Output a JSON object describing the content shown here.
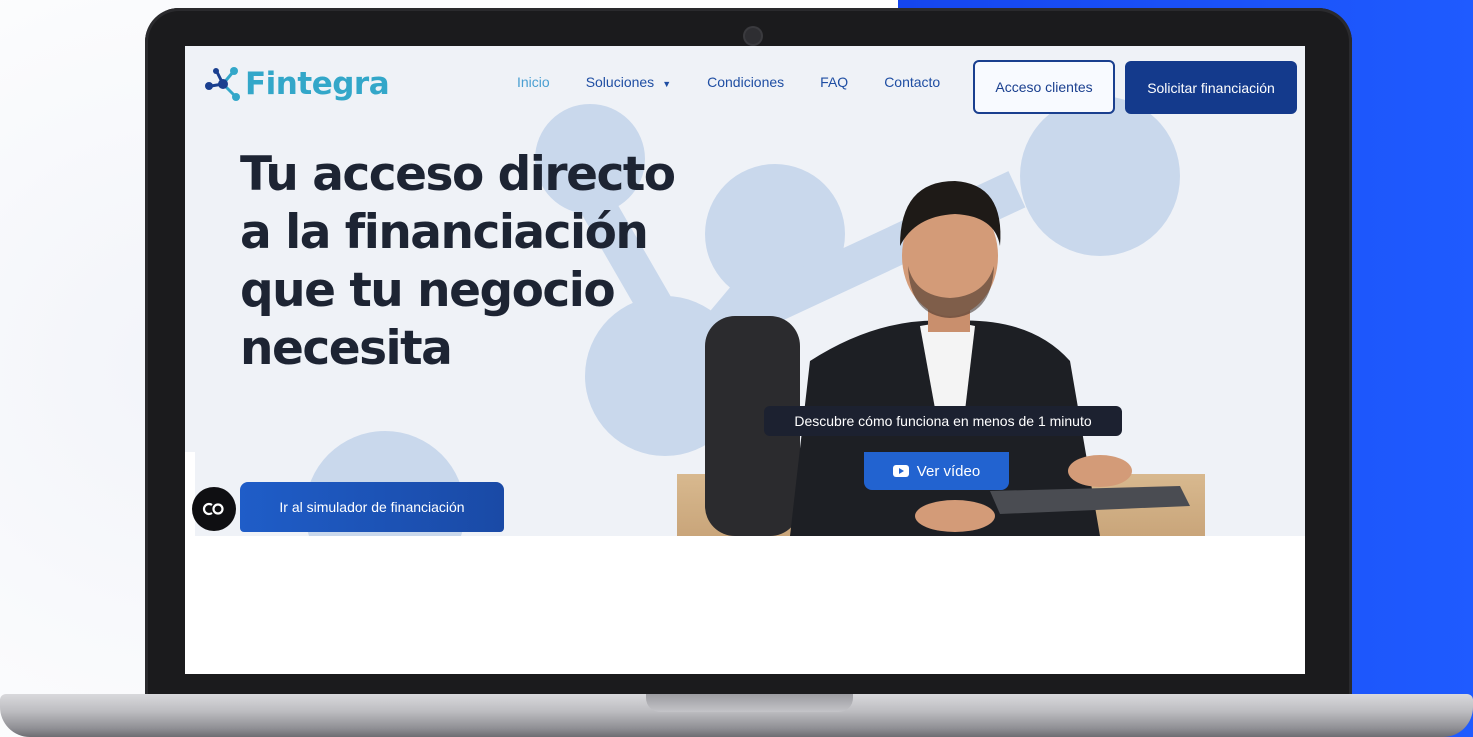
{
  "brand": {
    "name": "Fintegra",
    "primary_color": "#143a8c",
    "accent_color": "#33a7c9",
    "background_right": "#1f5bff"
  },
  "nav": {
    "items": [
      {
        "label": "Inicio",
        "active": true
      },
      {
        "label": "Soluciones",
        "has_dropdown": true
      },
      {
        "label": "Condiciones"
      },
      {
        "label": "FAQ"
      },
      {
        "label": "Contacto"
      }
    ],
    "client_access_label": "Acceso clientes",
    "apply_label": "Solicitar financiación"
  },
  "hero": {
    "headline": "Tu acceso directo a la financiación que tu negocio necesita",
    "video_tooltip": "Descubre cómo funciona en menos de 1 minuto",
    "video_button_label": "Ver vídeo",
    "video_icon": "youtube-play-icon",
    "simulator_button_label": "Ir al simulador de financiación",
    "captions_icon": "closed-captions-icon"
  }
}
